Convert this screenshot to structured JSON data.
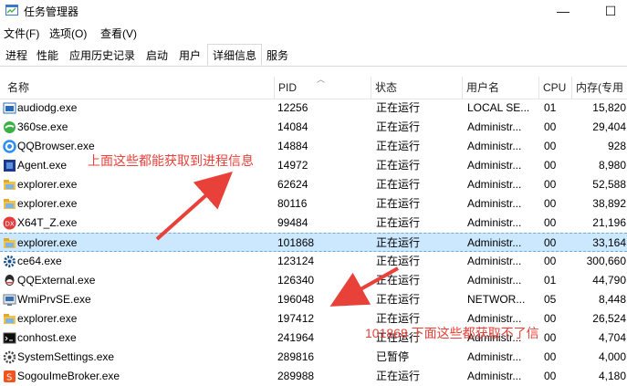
{
  "window": {
    "title": "任务管理器",
    "min_glyph": "—",
    "max_glyph": "☐"
  },
  "menu": [
    "文件(F)",
    "选项(O)",
    "查看(V)"
  ],
  "tabs": [
    "进程",
    "性能",
    "应用历史记录",
    "启动",
    "用户",
    "详细信息",
    "服务"
  ],
  "active_tab": "详细信息",
  "columns": {
    "name": "名称",
    "pid": "PID",
    "status": "状态",
    "user": "用户名",
    "cpu": "CPU",
    "mem": "内存(专用"
  },
  "rows": [
    {
      "name": "audiodg.exe",
      "pid": "12256",
      "status": "正在运行",
      "user": "LOCAL SE...",
      "cpu": "01",
      "mem": "15,820",
      "icon": "window-icon"
    },
    {
      "name": "360se.exe",
      "pid": "14084",
      "status": "正在运行",
      "user": "Administr...",
      "cpu": "00",
      "mem": "29,404",
      "icon": "360se-icon"
    },
    {
      "name": "QQBrowser.exe",
      "pid": "14884",
      "status": "正在运行",
      "user": "Administr...",
      "cpu": "00",
      "mem": "928",
      "icon": "qqbrowser-icon"
    },
    {
      "name": "Agent.exe",
      "pid": "14972",
      "status": "正在运行",
      "user": "Administr...",
      "cpu": "00",
      "mem": "8,980",
      "icon": "agent-icon"
    },
    {
      "name": "explorer.exe",
      "pid": "62624",
      "status": "正在运行",
      "user": "Administr...",
      "cpu": "00",
      "mem": "52,588",
      "icon": "folder-icon"
    },
    {
      "name": "explorer.exe",
      "pid": "80116",
      "status": "正在运行",
      "user": "Administr...",
      "cpu": "00",
      "mem": "38,892",
      "icon": "folder-icon"
    },
    {
      "name": "X64T_Z.exe",
      "pid": "99484",
      "status": "正在运行",
      "user": "Administr...",
      "cpu": "00",
      "mem": "21,196",
      "icon": "dx-icon"
    },
    {
      "name": "explorer.exe",
      "pid": "101868",
      "status": "正在运行",
      "user": "Administr...",
      "cpu": "00",
      "mem": "33,164",
      "icon": "folder-icon",
      "selected": true
    },
    {
      "name": "ce64.exe",
      "pid": "123124",
      "status": "正在运行",
      "user": "Administr...",
      "cpu": "00",
      "mem": "300,660",
      "icon": "gear-icon"
    },
    {
      "name": "QQExternal.exe",
      "pid": "126340",
      "status": "正在运行",
      "user": "Administr...",
      "cpu": "01",
      "mem": "44,790",
      "icon": "qq-icon"
    },
    {
      "name": "WmiPrvSE.exe",
      "pid": "196048",
      "status": "正在运行",
      "user": "NETWOR...",
      "cpu": "05",
      "mem": "8,448",
      "icon": "wmi-icon"
    },
    {
      "name": "explorer.exe",
      "pid": "197412",
      "status": "正在运行",
      "user": "Administr...",
      "cpu": "00",
      "mem": "26,524",
      "icon": "folder-icon"
    },
    {
      "name": "conhost.exe",
      "pid": "241964",
      "status": "正在运行",
      "user": "Administr...",
      "cpu": "00",
      "mem": "4,704",
      "icon": "console-icon"
    },
    {
      "name": "SystemSettings.exe",
      "pid": "289816",
      "status": "已暂停",
      "user": "Administr...",
      "cpu": "00",
      "mem": "4,000",
      "icon": "settings-icon"
    },
    {
      "name": "SogouImeBroker.exe",
      "pid": "289988",
      "status": "正在运行",
      "user": "Administr...",
      "cpu": "00",
      "mem": "4,180",
      "icon": "sogou-icon"
    }
  ],
  "annotations": {
    "top": "上面这些都能获取到进程信息",
    "bottom": "101868 下面这些都获取不了信"
  }
}
